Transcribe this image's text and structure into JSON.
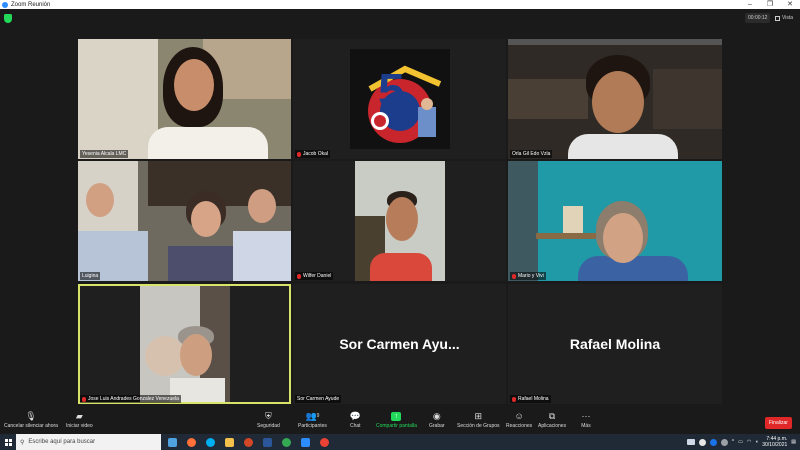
{
  "window": {
    "title": "Zoom Reunión",
    "controls": [
      "–",
      "❐",
      "✕"
    ]
  },
  "meeting": {
    "timer": "00:00:12",
    "view_label": "Vista"
  },
  "participants": [
    {
      "name": "Yesenia Alcala LMC",
      "muted": false,
      "kind": "video"
    },
    {
      "name": "Jacob Okal",
      "muted": true,
      "kind": "logo"
    },
    {
      "name": "Orla Gil Edo Vzla",
      "muted": false,
      "kind": "video"
    },
    {
      "name": "Luigina",
      "muted": false,
      "kind": "video"
    },
    {
      "name": "Wilfer Daniel",
      "muted": true,
      "kind": "video"
    },
    {
      "name": "Mario y Vivi",
      "muted": true,
      "kind": "video"
    },
    {
      "name": "Jose Luis Andrades Gonzalez Venezuela",
      "muted": true,
      "kind": "video",
      "active_speaker": true
    },
    {
      "name": "Sor Carmen Ayude",
      "display": "Sor  Carmen  Ayu...",
      "muted": false,
      "kind": "name"
    },
    {
      "name": "Rafael Molina",
      "display": "Rafael Molina",
      "muted": true,
      "kind": "name"
    }
  ],
  "toolbar": {
    "unmute": "Cancelar silenciar ahora",
    "video": "Iniciar video",
    "security": "Seguridad",
    "participants": "Participantes",
    "participants_count": "9",
    "chat": "Chat",
    "share": "Compartir pantalla",
    "record": "Grabar",
    "breakout": "Sección de Grupos",
    "reactions": "Reacciones",
    "apps": "Aplicaciones",
    "more": "Más",
    "end": "Finalizar"
  },
  "taskbar": {
    "search_placeholder": "Escribe aquí para buscar",
    "time": "7:44 p.m.",
    "date": "30/10/2021",
    "tray_arrow": "^"
  },
  "colors": {
    "active_speaker": "#d8e36a",
    "share_green": "#23d959",
    "end_red": "#e02828",
    "muted_red": "#e02828"
  }
}
